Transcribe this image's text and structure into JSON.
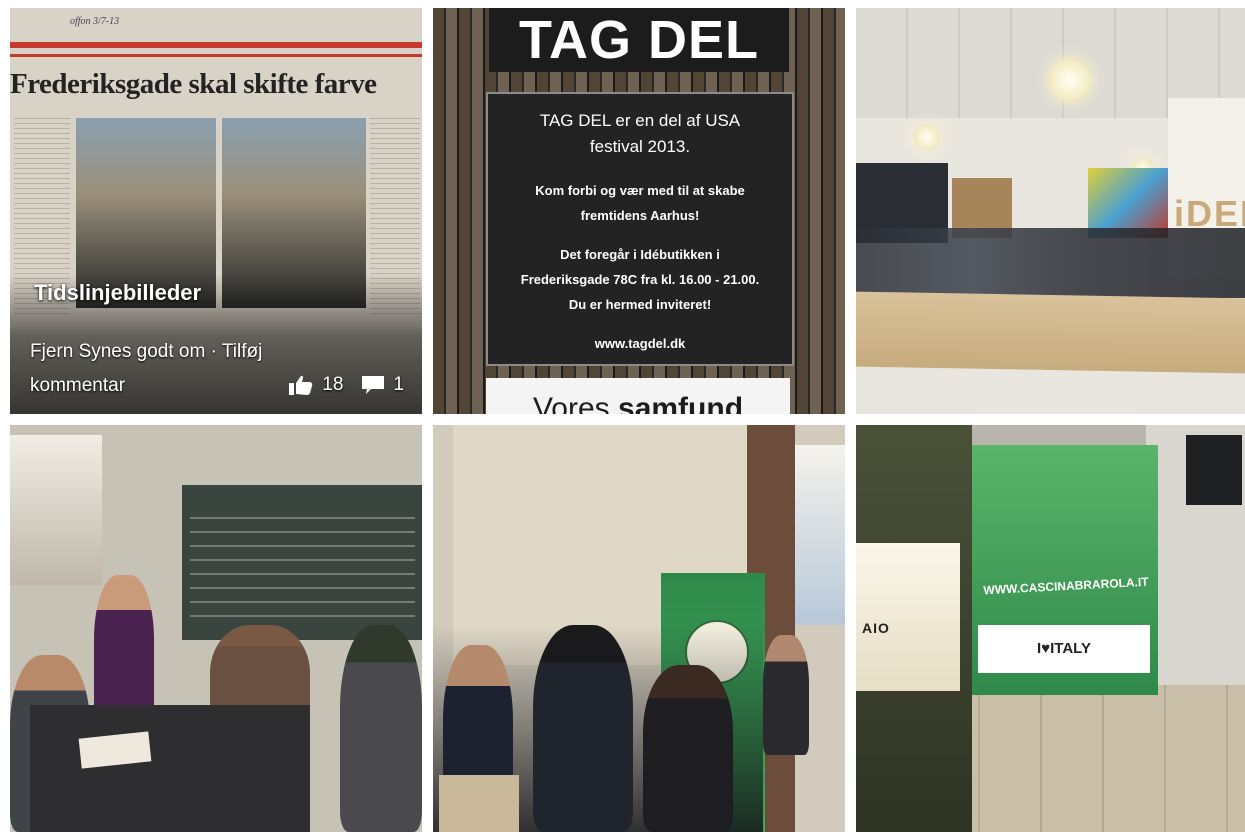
{
  "album": {
    "title": "Tidslinjebilleder",
    "actions": {
      "unlike": "Fjern Synes godt om",
      "separator": "·",
      "comment": "Tilføj",
      "comment_cont": "kommentar"
    },
    "likes": "18",
    "comments": "1"
  },
  "photo1": {
    "headline": "Frederiksgade skal skifte farve",
    "handwritten": "offon 3/7-13"
  },
  "photo2": {
    "header": "TAG DEL",
    "line1": "TAG DEL er en del af USA",
    "line2": "festival 2013.",
    "line3": "Kom forbi og vær med til at skabe",
    "line4": "fremtidens Aarhus!",
    "line5": "Det foregår i Idébutikken i",
    "line6": "Frederiksgade 78C fra kl. 16.00 - 21.00.",
    "line7": "Du er hermed inviteret!",
    "url": "www.tagdel.dk",
    "footer_a": "Vores ",
    "footer_b": "samfund"
  },
  "photo3": {
    "wall_text": "iDEB"
  },
  "photo6": {
    "banner_url": "WWW.CASCINABRAROLA.IT",
    "logo_text": "I♥ITALY",
    "bag_text": "AIO"
  },
  "colors": {
    "accent_red": "#c43a2c",
    "banner_green": "#2f8a4a"
  }
}
